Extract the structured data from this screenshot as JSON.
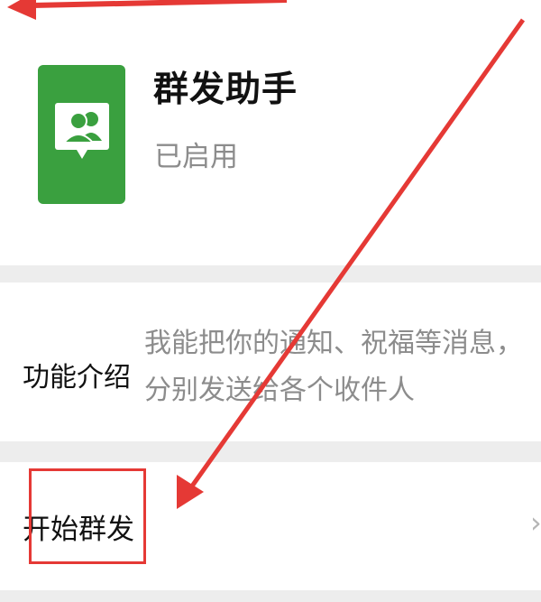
{
  "app": {
    "name": "群发助手",
    "status": "已启用",
    "icon": "group-chat-icon",
    "icon_color": "#3aa03f"
  },
  "intro": {
    "label": "功能介绍",
    "text": "我能把你的通知、祝福等消息，分别发送给各个收件人"
  },
  "start": {
    "label": "开始群发",
    "chevron": "›"
  },
  "annotation": {
    "color": "#e53935"
  }
}
